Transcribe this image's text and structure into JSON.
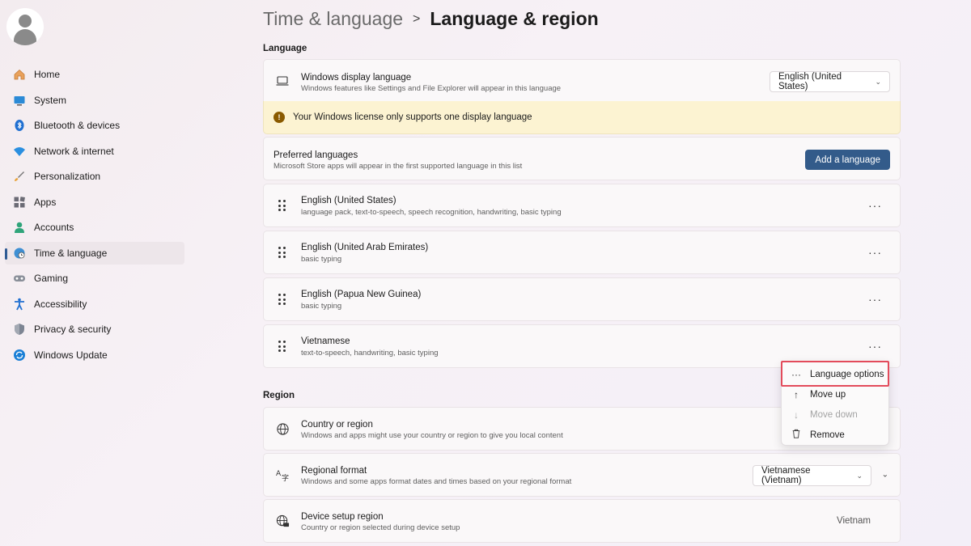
{
  "breadcrumb": {
    "parent": "Time & language",
    "separator": ">",
    "current": "Language & region"
  },
  "sidebar": {
    "items": [
      {
        "label": "Home",
        "icon": "home-icon"
      },
      {
        "label": "System",
        "icon": "system-icon"
      },
      {
        "label": "Bluetooth & devices",
        "icon": "bluetooth-icon"
      },
      {
        "label": "Network & internet",
        "icon": "wifi-icon"
      },
      {
        "label": "Personalization",
        "icon": "brush-icon"
      },
      {
        "label": "Apps",
        "icon": "apps-icon"
      },
      {
        "label": "Accounts",
        "icon": "account-icon"
      },
      {
        "label": "Time & language",
        "icon": "globe-clock-icon",
        "active": true
      },
      {
        "label": "Gaming",
        "icon": "gamepad-icon"
      },
      {
        "label": "Accessibility",
        "icon": "accessibility-icon"
      },
      {
        "label": "Privacy & security",
        "icon": "shield-icon"
      },
      {
        "label": "Windows Update",
        "icon": "update-icon"
      }
    ]
  },
  "language": {
    "section_title": "Language",
    "display_language": {
      "title": "Windows display language",
      "subtitle": "Windows features like Settings and File Explorer will appear in this language",
      "value": "English (United States)"
    },
    "warning": "Your Windows license only supports one display language",
    "preferred": {
      "title": "Preferred languages",
      "subtitle": "Microsoft Store apps will appear in the first supported language in this list",
      "button": "Add a language"
    },
    "languages": [
      {
        "name": "English (United States)",
        "features": "language pack, text-to-speech, speech recognition, handwriting, basic typing"
      },
      {
        "name": "English (United Arab Emirates)",
        "features": "basic typing"
      },
      {
        "name": "English (Papua New Guinea)",
        "features": "basic typing"
      },
      {
        "name": "Vietnamese",
        "features": "text-to-speech, handwriting, basic typing"
      }
    ],
    "more_label": "···"
  },
  "context_menu": {
    "items": [
      {
        "label": "Language options",
        "icon": "more-icon",
        "glyph": "···"
      },
      {
        "label": "Move up",
        "icon": "arrow-up-icon",
        "glyph": "↑"
      },
      {
        "label": "Move down",
        "icon": "arrow-down-icon",
        "glyph": "↓",
        "disabled": true
      },
      {
        "label": "Remove",
        "icon": "trash-icon",
        "glyph": "🗑"
      }
    ]
  },
  "region": {
    "section_title": "Region",
    "country": {
      "title": "Country or region",
      "subtitle": "Windows and apps might use your country or region to give you local content"
    },
    "format": {
      "title": "Regional format",
      "subtitle": "Windows and some apps format dates and times based on your regional format",
      "value": "Vietnamese (Vietnam)"
    },
    "device_region": {
      "title": "Device setup region",
      "subtitle": "Country or region selected during device setup",
      "value": "Vietnam"
    }
  },
  "colors": {
    "accent": "#335b8a",
    "warning_bg": "#fcf3d2",
    "highlight": "#e34b5b"
  }
}
